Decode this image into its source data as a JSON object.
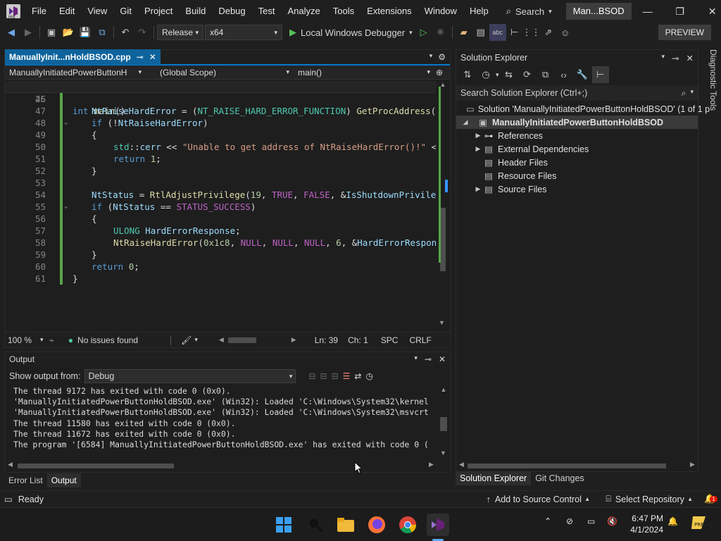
{
  "menu": [
    "File",
    "Edit",
    "View",
    "Git",
    "Project",
    "Build",
    "Debug",
    "Test",
    "Analyze",
    "Tools",
    "Extensions",
    "Window",
    "Help"
  ],
  "search_label": "Search",
  "solution_name_short": "Man...BSOD",
  "toolbar": {
    "configuration": "Release",
    "platform": "x64",
    "debugger": "Local Windows Debugger",
    "preview_label": "PREVIEW"
  },
  "editor": {
    "tab_title": "ManuallyInit...nHoldBSOD.cpp",
    "project_combo": "ManuallyInitiatedPowerButtonH",
    "scope_combo": "(Global Scope)",
    "member_combo": "main()",
    "sticky_line": {
      "num": "25",
      "text": "int main()"
    },
    "lines": [
      {
        "num": "46",
        "html": ""
      },
      {
        "num": "47",
        "indent": 1,
        "parts": [
          [
            "var",
            "NtRaiseHardError"
          ],
          [
            "pl",
            " = ("
          ],
          [
            "ty",
            "NT_RAISE_HARD_ERROR_FUNCTION"
          ],
          [
            "pl",
            ") "
          ],
          [
            "fn",
            "GetProcAddress"
          ],
          [
            "pl",
            "("
          ]
        ]
      },
      {
        "num": "48",
        "indent": 1,
        "parts": [
          [
            "kw",
            "if"
          ],
          [
            "pl",
            " (!"
          ],
          [
            "var",
            "NtRaiseHardError"
          ],
          [
            "pl",
            ")"
          ]
        ]
      },
      {
        "num": "49",
        "indent": 1,
        "parts": [
          [
            "pl",
            "{"
          ]
        ]
      },
      {
        "num": "50",
        "indent": 2,
        "parts": [
          [
            "ty",
            "std"
          ],
          [
            "pl",
            "::"
          ],
          [
            "var",
            "cerr"
          ],
          [
            "pl",
            " << "
          ],
          [
            "str",
            "\"Unable to get address of NtRaiseHardError()!\""
          ],
          [
            "pl",
            " <"
          ]
        ]
      },
      {
        "num": "51",
        "indent": 2,
        "parts": [
          [
            "kw",
            "return"
          ],
          [
            "pl",
            " "
          ],
          [
            "num",
            "1"
          ],
          [
            "pl",
            ";"
          ]
        ]
      },
      {
        "num": "52",
        "indent": 1,
        "parts": [
          [
            "pl",
            "}"
          ]
        ]
      },
      {
        "num": "53",
        "indent": 0,
        "parts": []
      },
      {
        "num": "54",
        "indent": 1,
        "parts": [
          [
            "var",
            "NtStatus"
          ],
          [
            "pl",
            " = "
          ],
          [
            "fn",
            "RtlAdjustPrivilege"
          ],
          [
            "pl",
            "("
          ],
          [
            "num",
            "19"
          ],
          [
            "pl",
            ", "
          ],
          [
            "mc",
            "TRUE"
          ],
          [
            "pl",
            ", "
          ],
          [
            "mc",
            "FALSE"
          ],
          [
            "pl",
            ", &"
          ],
          [
            "var",
            "IsShutdownPrivile"
          ]
        ]
      },
      {
        "num": "55",
        "indent": 1,
        "parts": [
          [
            "kw",
            "if"
          ],
          [
            "pl",
            " ("
          ],
          [
            "var",
            "NtStatus"
          ],
          [
            "pl",
            " == "
          ],
          [
            "mc",
            "STATUS_SUCCESS"
          ],
          [
            "pl",
            ")"
          ]
        ]
      },
      {
        "num": "56",
        "indent": 1,
        "parts": [
          [
            "pl",
            "{"
          ]
        ]
      },
      {
        "num": "57",
        "indent": 2,
        "parts": [
          [
            "ty",
            "ULONG"
          ],
          [
            "pl",
            " "
          ],
          [
            "var",
            "HardErrorResponse"
          ],
          [
            "pl",
            ";"
          ]
        ]
      },
      {
        "num": "58",
        "indent": 2,
        "parts": [
          [
            "fn",
            "NtRaiseHardError"
          ],
          [
            "pl",
            "("
          ],
          [
            "num",
            "0x1c8"
          ],
          [
            "pl",
            ", "
          ],
          [
            "mc",
            "NULL"
          ],
          [
            "pl",
            ", "
          ],
          [
            "mc",
            "NULL"
          ],
          [
            "pl",
            ", "
          ],
          [
            "mc",
            "NULL"
          ],
          [
            "pl",
            ", "
          ],
          [
            "num",
            "6"
          ],
          [
            "pl",
            ", &"
          ],
          [
            "var",
            "HardErrorRespon"
          ]
        ]
      },
      {
        "num": "59",
        "indent": 1,
        "parts": [
          [
            "pl",
            "}"
          ]
        ]
      },
      {
        "num": "60",
        "indent": 1,
        "parts": [
          [
            "kw",
            "return"
          ],
          [
            "pl",
            " "
          ],
          [
            "num",
            "0"
          ],
          [
            "pl",
            ";"
          ]
        ]
      },
      {
        "num": "61",
        "indent": 0,
        "parts": [
          [
            "pl",
            "}"
          ]
        ]
      }
    ],
    "zoom": "100 %",
    "issues": "No issues found",
    "position_line": "Ln: 39",
    "position_char": "Ch: 1",
    "whitespace_mode": "SPC",
    "line_ending": "CRLF"
  },
  "output": {
    "title": "Output",
    "show_from_label": "Show output from:",
    "source": "Debug",
    "lines": [
      "The thread 9172 has exited with code 0 (0x0).",
      "'ManuallyInitiatedPowerButtonHoldBSOD.exe' (Win32): Loaded 'C:\\Windows\\System32\\kernel",
      "'ManuallyInitiatedPowerButtonHoldBSOD.exe' (Win32): Loaded 'C:\\Windows\\System32\\msvcrt",
      "The thread 11580 has exited with code 0 (0x0).",
      "The thread 11672 has exited with code 0 (0x0).",
      "The program '[6584] ManuallyInitiatedPowerButtonHoldBSOD.exe' has exited with code 0 ("
    ]
  },
  "bottom_tabs": [
    "Error List",
    "Output"
  ],
  "solution_explorer": {
    "title": "Solution Explorer",
    "search_placeholder": "Search Solution Explorer (Ctrl+;)",
    "solution_row": "Solution 'ManuallyInitiatedPowerButtonHoldBSOD' (1 of 1 p",
    "project_row": "ManuallyInitiatedPowerButtonHoldBSOD",
    "items": [
      "References",
      "External Dependencies",
      "Header Files",
      "Resource Files",
      "Source Files"
    ],
    "tabs": [
      "Solution Explorer",
      "Git Changes"
    ]
  },
  "diagnostic_tools": "Diagnostic Tools",
  "status_bar": {
    "ready": "Ready",
    "source_control": "Add to Source Control",
    "repository": "Select Repository",
    "notification_count": "1"
  },
  "taskbar": {
    "time": "6:47 PM",
    "date": "4/1/2024"
  },
  "colors": {
    "accent": "#007acc",
    "tab_active": "#0e639c",
    "change_bar": "#57a64a"
  }
}
